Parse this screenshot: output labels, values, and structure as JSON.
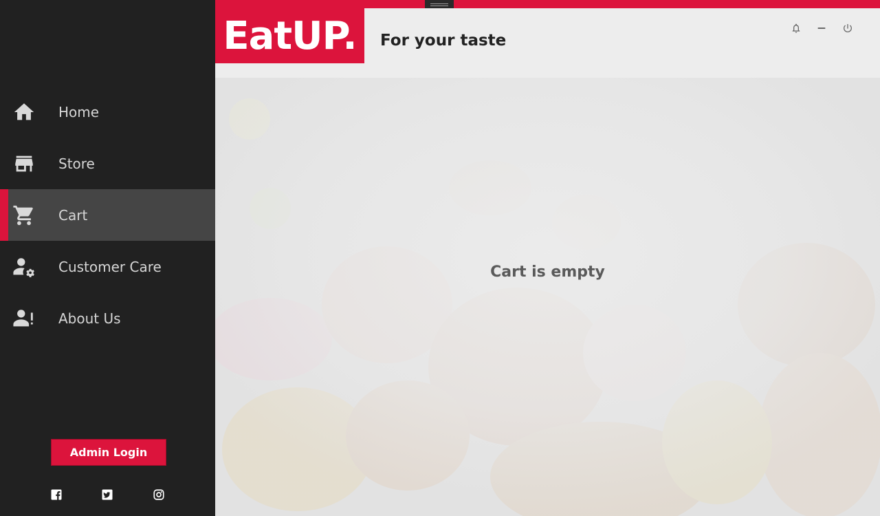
{
  "brand": {
    "logo": "EatUP.",
    "tagline": "For your taste",
    "accent": "#dc143c"
  },
  "sidebar": {
    "items": [
      {
        "label": "Home",
        "icon": "home-icon"
      },
      {
        "label": "Store",
        "icon": "store-icon"
      },
      {
        "label": "Cart",
        "icon": "cart-icon",
        "active": true
      },
      {
        "label": "Customer Care",
        "icon": "user-gear-icon"
      },
      {
        "label": "About Us",
        "icon": "user-info-icon"
      }
    ],
    "admin_button": "Admin Login",
    "social": [
      "facebook-icon",
      "twitter-icon",
      "instagram-icon"
    ]
  },
  "window_controls": [
    "bell-icon",
    "minimize-icon",
    "power-icon"
  ],
  "main": {
    "message": "Cart is empty"
  }
}
